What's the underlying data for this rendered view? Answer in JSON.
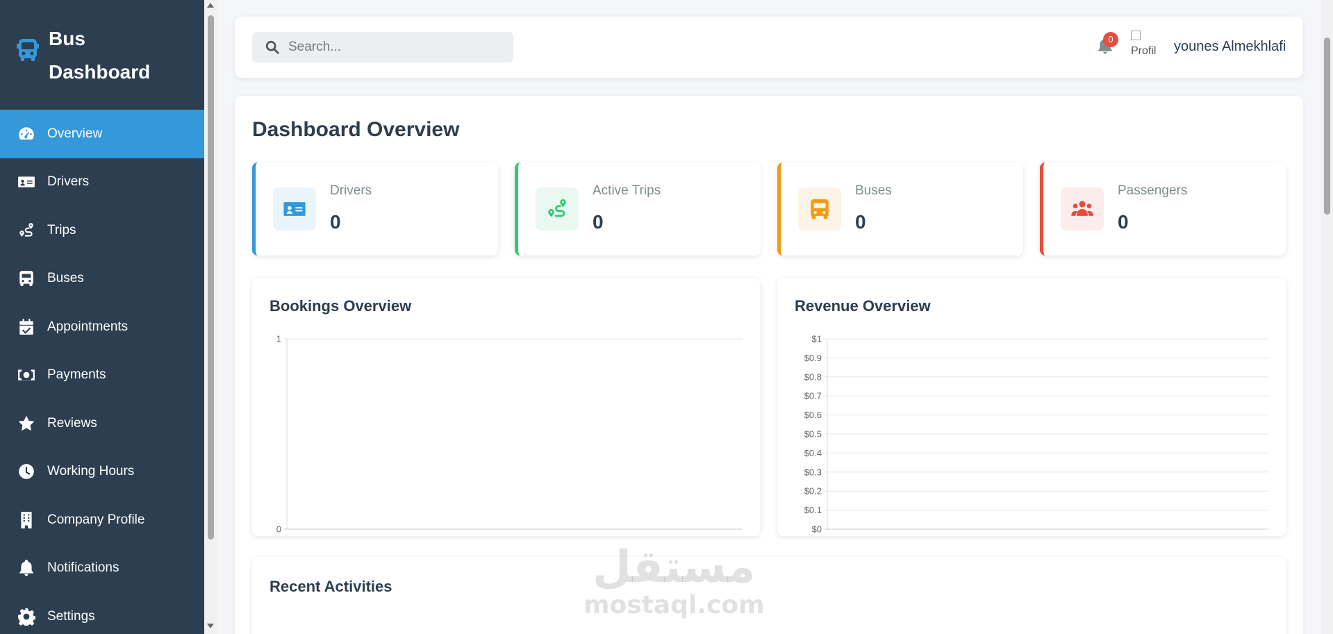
{
  "sidebar": {
    "brand_line1": "Bus",
    "brand_line2": "Dashboard",
    "items": [
      {
        "label": "Overview",
        "icon": "gauge-icon",
        "active": true
      },
      {
        "label": "Drivers",
        "icon": "id-card-icon"
      },
      {
        "label": "Trips",
        "icon": "route-icon"
      },
      {
        "label": "Buses",
        "icon": "bus-icon"
      },
      {
        "label": "Appointments",
        "icon": "calendar-check-icon"
      },
      {
        "label": "Payments",
        "icon": "money-bill-icon"
      },
      {
        "label": "Reviews",
        "icon": "star-icon"
      },
      {
        "label": "Working Hours",
        "icon": "clock-icon"
      },
      {
        "label": "Company Profile",
        "icon": "building-icon"
      },
      {
        "label": "Notifications",
        "icon": "bell-icon"
      },
      {
        "label": "Settings",
        "icon": "gear-icon"
      }
    ]
  },
  "header": {
    "search_placeholder": "Search...",
    "notification_count": "0",
    "avatar_alt": "Profil",
    "username": "younes Almekhlafi"
  },
  "page": {
    "title": "Dashboard Overview"
  },
  "stats": [
    {
      "label": "Drivers",
      "value": "0",
      "color": "#3498db",
      "bg": "#eaf4fb"
    },
    {
      "label": "Active Trips",
      "value": "0",
      "color": "#2ecc71",
      "bg": "#e9f8f0"
    },
    {
      "label": "Buses",
      "value": "0",
      "color": "#f39c12",
      "bg": "#fdf3e6"
    },
    {
      "label": "Passengers",
      "value": "0",
      "color": "#e74c3c",
      "bg": "#fceceb"
    }
  ],
  "chart_data": [
    {
      "type": "line",
      "title": "Bookings Overview",
      "x": [],
      "series": [],
      "ylim": [
        0,
        1
      ],
      "yticks": [
        "1",
        "0"
      ],
      "grid": true
    },
    {
      "type": "line",
      "title": "Revenue Overview",
      "x": [],
      "series": [],
      "ylim": [
        0,
        1
      ],
      "yticks": [
        "$1",
        "$0.9",
        "$0.8",
        "$0.7",
        "$0.6",
        "$0.5",
        "$0.4",
        "$0.3",
        "$0.2",
        "$0.1",
        "$0"
      ],
      "grid": true
    }
  ],
  "activities": {
    "title": "Recent Activities"
  },
  "watermark": {
    "arabic": "مستقل",
    "latin": "mostaql.com"
  }
}
